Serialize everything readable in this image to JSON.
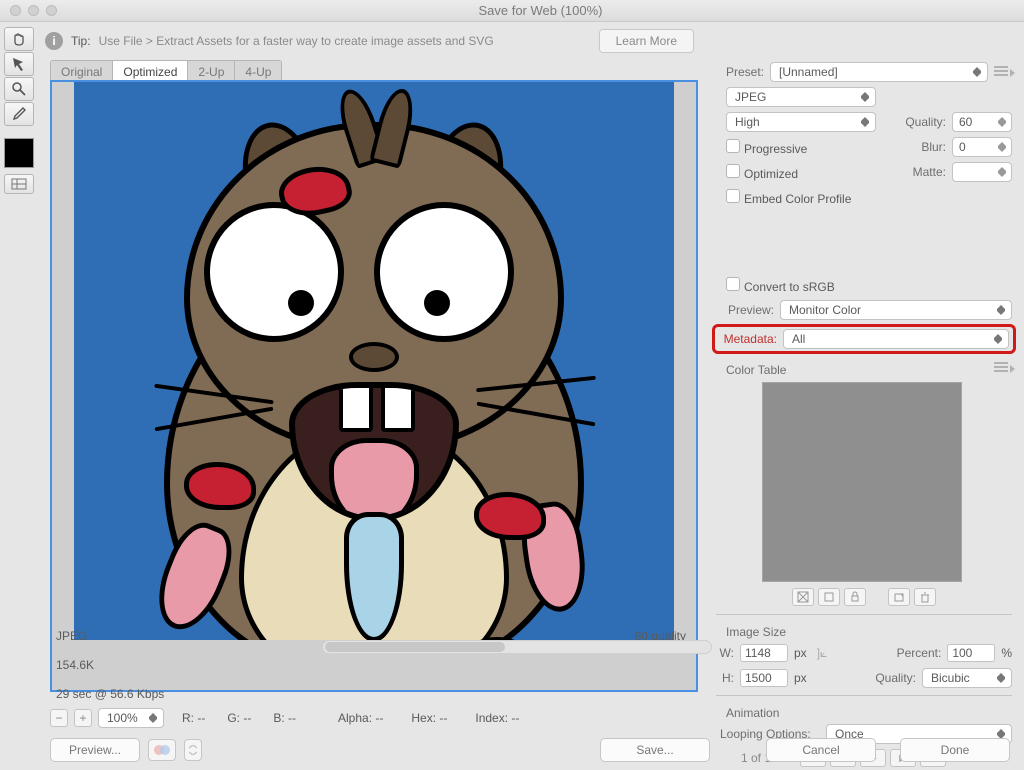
{
  "window": {
    "title": "Save for Web (100%)"
  },
  "tip": {
    "prefix": "Tip:",
    "text": "Use File > Extract Assets for a faster way to create image assets and SVG",
    "learn": "Learn More"
  },
  "tabs": [
    "Original",
    "Optimized",
    "2-Up",
    "4-Up"
  ],
  "active_tab": 1,
  "preview_info": {
    "format": "JPEG",
    "size": "154.6K",
    "speed": "29 sec @ 56.6 Kbps",
    "quality": "60 quality"
  },
  "settings": {
    "preset_label": "Preset:",
    "preset_value": "[Unnamed]",
    "format_value": "JPEG",
    "quality_preset": "High",
    "quality_label": "Quality:",
    "quality_value": "60",
    "progressive": "Progressive",
    "blur_label": "Blur:",
    "blur_value": "0",
    "optimized": "Optimized",
    "matte_label": "Matte:",
    "embed": "Embed Color Profile",
    "convert": "Convert to sRGB",
    "preview_label": "Preview:",
    "preview_value": "Monitor Color",
    "metadata_label": "Metadata:",
    "metadata_value": "All",
    "colortable_label": "Color Table"
  },
  "image_size": {
    "title": "Image Size",
    "w_label": "W:",
    "w_value": "1148",
    "h_label": "H:",
    "h_value": "1500",
    "px": "px",
    "percent_label": "Percent:",
    "percent_value": "100",
    "percent_unit": "%",
    "quality_label": "Quality:",
    "quality_value": "Bicubic"
  },
  "animation": {
    "title": "Animation",
    "loop_label": "Looping Options:",
    "loop_value": "Once",
    "page": "1 of 1"
  },
  "status": {
    "zoom": "100%",
    "r": "R: --",
    "g": "G: --",
    "b": "B: --",
    "alpha": "Alpha: --",
    "hex": "Hex: --",
    "index": "Index: --"
  },
  "buttons": {
    "preview": "Preview...",
    "save": "Save...",
    "cancel": "Cancel",
    "done": "Done"
  }
}
